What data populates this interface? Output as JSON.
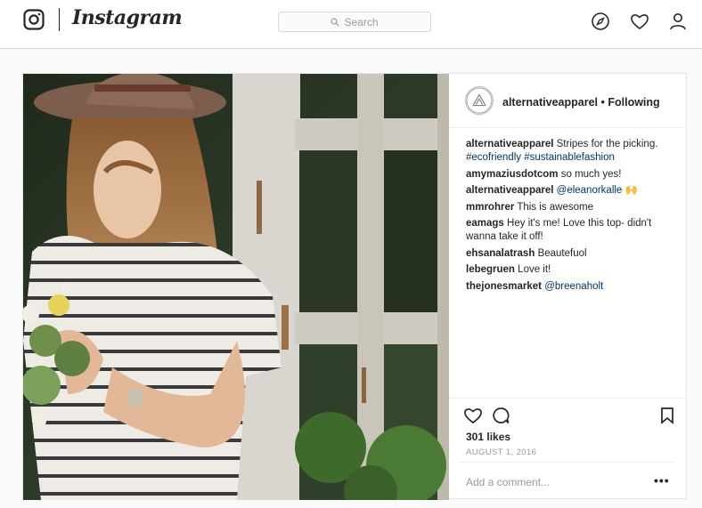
{
  "header": {
    "wordmark": "Instagram",
    "search_placeholder": "Search"
  },
  "post": {
    "account": "alternativeapparel",
    "separator": "•",
    "follow_status": "Following",
    "comments": [
      {
        "user": "alternativeapparel",
        "text": "Stripes for the picking. ",
        "tags": "#ecofriendly #sustainablefashion"
      },
      {
        "user": "amymaziusdotcom",
        "text": "so much yes!"
      },
      {
        "user": "alternativeapparel",
        "tags": "@eleanorkalle",
        "emoji": "🙌"
      },
      {
        "user": "mmrohrer",
        "text": "This is awesome"
      },
      {
        "user": "eamags",
        "text": "Hey it's me! Love this top- didn't wanna take it off!"
      },
      {
        "user": "ehsanalatrash",
        "text": "Beautefuol"
      },
      {
        "user": "lebegruen",
        "text": "Love it!"
      },
      {
        "user": "thejonesmarket",
        "tags": "@breenaholt"
      }
    ],
    "likes": "301 likes",
    "date": "AUGUST 1, 2016",
    "add_comment_placeholder": "Add a comment...",
    "more": "•••"
  },
  "icons": {
    "logo": "instagram-glyph-icon",
    "search": "search-icon",
    "explore": "compass-icon",
    "activity": "heart-icon",
    "profile": "person-icon",
    "like": "heart-icon",
    "comment": "comment-bubble-icon",
    "save": "bookmark-icon"
  },
  "colors": {
    "link": "#003569",
    "text": "#262626",
    "muted": "#999999",
    "border": "#dbdbdb"
  }
}
